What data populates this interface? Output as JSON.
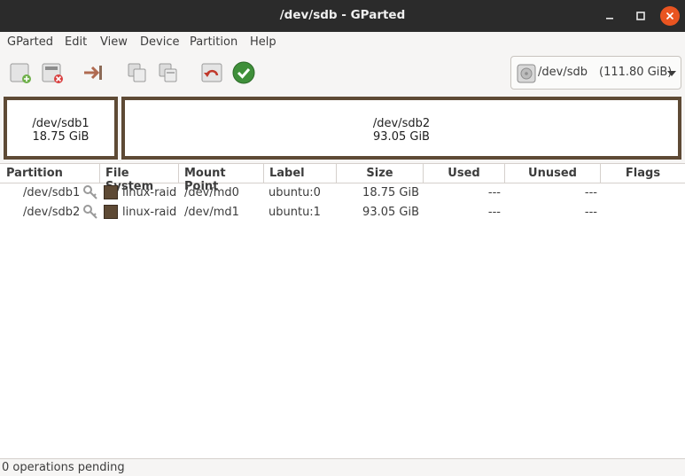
{
  "window": {
    "title": "/dev/sdb - GParted"
  },
  "menu": [
    "GParted",
    "Edit",
    "View",
    "Device",
    "Partition",
    "Help"
  ],
  "toolbar": {
    "buttons": [
      "new-partition",
      "delete-partition",
      "resize-move",
      "copy",
      "paste",
      "undo",
      "apply"
    ]
  },
  "device": {
    "name": "/dev/sdb",
    "size": "(111.80 GiB)"
  },
  "visual": [
    {
      "name": "/dev/sdb1",
      "size": "18.75 GiB"
    },
    {
      "name": "/dev/sdb2",
      "size": "93.05 GiB"
    }
  ],
  "table": {
    "columns": [
      "Partition",
      "File System",
      "Mount Point",
      "Label",
      "Size",
      "Used",
      "Unused",
      "Flags"
    ],
    "rows": [
      {
        "partition": "/dev/sdb1",
        "filesystem": "linux-raid",
        "mount": "/dev/md0",
        "label": "ubuntu:0",
        "size": "18.75 GiB",
        "used": "---",
        "unused": "---",
        "flags": ""
      },
      {
        "partition": "/dev/sdb2",
        "filesystem": "linux-raid",
        "mount": "/dev/md1",
        "label": "ubuntu:1",
        "size": "93.05 GiB",
        "used": "---",
        "unused": "---",
        "flags": ""
      }
    ]
  },
  "colors": {
    "linux_raid": "#5e4a35",
    "accent": "#e95420"
  },
  "status": {
    "text": "0 operations pending"
  }
}
